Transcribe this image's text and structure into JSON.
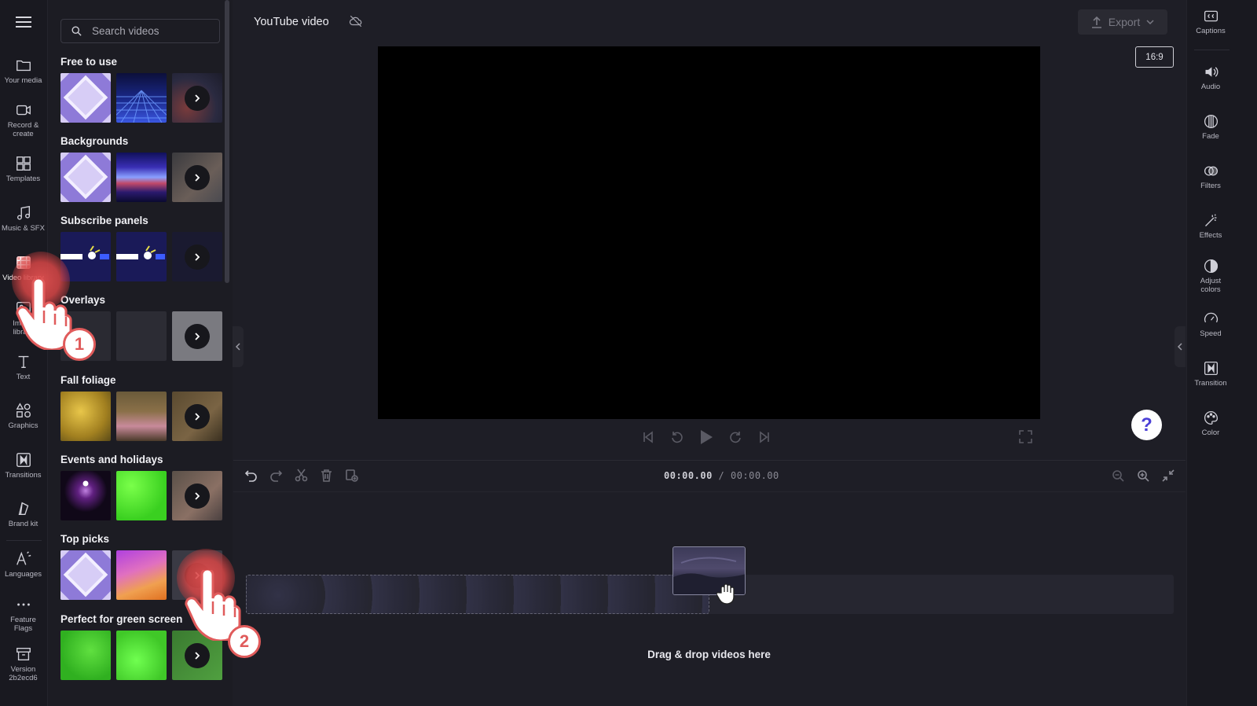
{
  "app": {
    "project_title": "YouTube video",
    "export_label": "Export",
    "aspect_ratio": "16:9",
    "help_label": "?"
  },
  "left_rail": {
    "items": [
      {
        "label": "Your media",
        "icon": "folder-icon"
      },
      {
        "label": "Record &\ncreate",
        "icon": "video-camera-icon"
      },
      {
        "label": "Templates",
        "icon": "templates-icon"
      },
      {
        "label": "Music & SFX",
        "icon": "music-note-icon"
      },
      {
        "label": "Video library",
        "icon": "film-icon",
        "active": true
      },
      {
        "label": "Image\nlibrary",
        "icon": "image-icon"
      },
      {
        "label": "Text",
        "icon": "text-icon"
      },
      {
        "label": "Graphics",
        "icon": "graphics-icon"
      },
      {
        "label": "Transitions",
        "icon": "transitions-icon"
      },
      {
        "label": "Brand kit",
        "icon": "brand-kit-icon"
      },
      {
        "label": "Languages",
        "icon": "languages-icon"
      },
      {
        "label": "Feature\nFlags",
        "icon": "more-dots-icon"
      },
      {
        "label": "Version\n2b2ecd6",
        "icon": "archive-icon"
      }
    ]
  },
  "library": {
    "search_placeholder": "Search videos",
    "sections": [
      {
        "title": "Free to use"
      },
      {
        "title": "Backgrounds"
      },
      {
        "title": "Subscribe panels"
      },
      {
        "title": "Overlays"
      },
      {
        "title": "Fall foliage"
      },
      {
        "title": "Events and holidays"
      },
      {
        "title": "Top picks"
      },
      {
        "title": "Perfect for green screen"
      }
    ]
  },
  "timeline": {
    "current_time": "00:00.00",
    "separator": " / ",
    "total_time": "00:00.00",
    "drop_text": "Drag & drop videos here"
  },
  "right_rail": {
    "items": [
      {
        "label": "Captions",
        "icon": "captions-icon"
      },
      {
        "label": "Audio",
        "icon": "speaker-icon"
      },
      {
        "label": "Fade",
        "icon": "fade-icon"
      },
      {
        "label": "Filters",
        "icon": "filters-icon"
      },
      {
        "label": "Effects",
        "icon": "magic-wand-icon"
      },
      {
        "label": "Adjust\ncolors",
        "icon": "contrast-icon"
      },
      {
        "label": "Speed",
        "icon": "speedometer-icon"
      },
      {
        "label": "Transition",
        "icon": "transition-icon"
      },
      {
        "label": "Color",
        "icon": "palette-icon"
      }
    ]
  },
  "tutorial": {
    "step1": "1",
    "step2": "2"
  },
  "colors": {
    "accent_red": "#e05b5b",
    "help_blue": "#4b3fd6",
    "background": "#1e1e26"
  }
}
